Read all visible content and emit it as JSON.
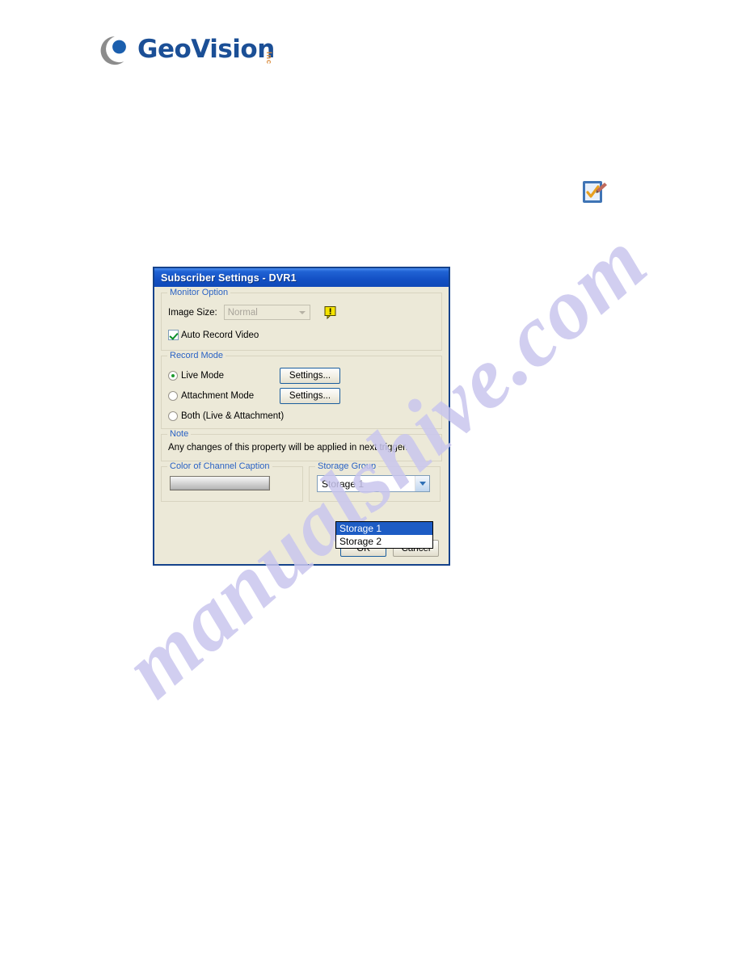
{
  "page": {
    "watermark": "manualshive.com"
  },
  "brand": {
    "name": "GeoVision",
    "suffix": "Inc",
    "logo_icon": "geovision-crescent-logo",
    "wordmark_color": "#1b4f96",
    "suffix_color": "#d98a3a"
  },
  "page_icon": {
    "name": "document-edit-icon",
    "description": "blue tablet with checkmark and pen"
  },
  "dialog": {
    "title": "Subscriber Settings - DVR1",
    "titlebar_color": "#1350c4",
    "border_color": "#15428b",
    "face_color": "#ece9d8",
    "group_label_color": "#2a62c4",
    "monitor_option": {
      "legend": "Monitor Option",
      "image_size_label": "Image Size:",
      "image_size_value": "Normal",
      "image_size_disabled": true,
      "warning_icon": "yellow-exclamation-callout-icon",
      "auto_record_label": "Auto Record Video",
      "auto_record_checked": true
    },
    "record_mode": {
      "legend": "Record Mode",
      "options": [
        {
          "label": "Live Mode",
          "checked": true,
          "has_settings_button": true,
          "settings_label": "Settings..."
        },
        {
          "label": "Attachment Mode",
          "checked": false,
          "has_settings_button": true,
          "settings_label": "Settings..."
        },
        {
          "label": "Both (Live & Attachment)",
          "checked": false,
          "has_settings_button": false,
          "settings_label": ""
        }
      ]
    },
    "note": {
      "legend": "Note",
      "text": "Any changes of this property will be applied in next trigger."
    },
    "color_of_channel_caption": {
      "legend": "Color of Channel Caption",
      "swatch_name": "channel-caption-color-swatch"
    },
    "storage_group": {
      "legend": "Storage Group",
      "selected": "Storage 1",
      "expanded": true,
      "options": [
        {
          "label": "Storage 1",
          "selected": true
        },
        {
          "label": "Storage 2",
          "selected": false
        }
      ],
      "highlight_color": "#1d5cc4"
    },
    "buttons": {
      "ok": "OK",
      "cancel": "Cancel"
    }
  }
}
